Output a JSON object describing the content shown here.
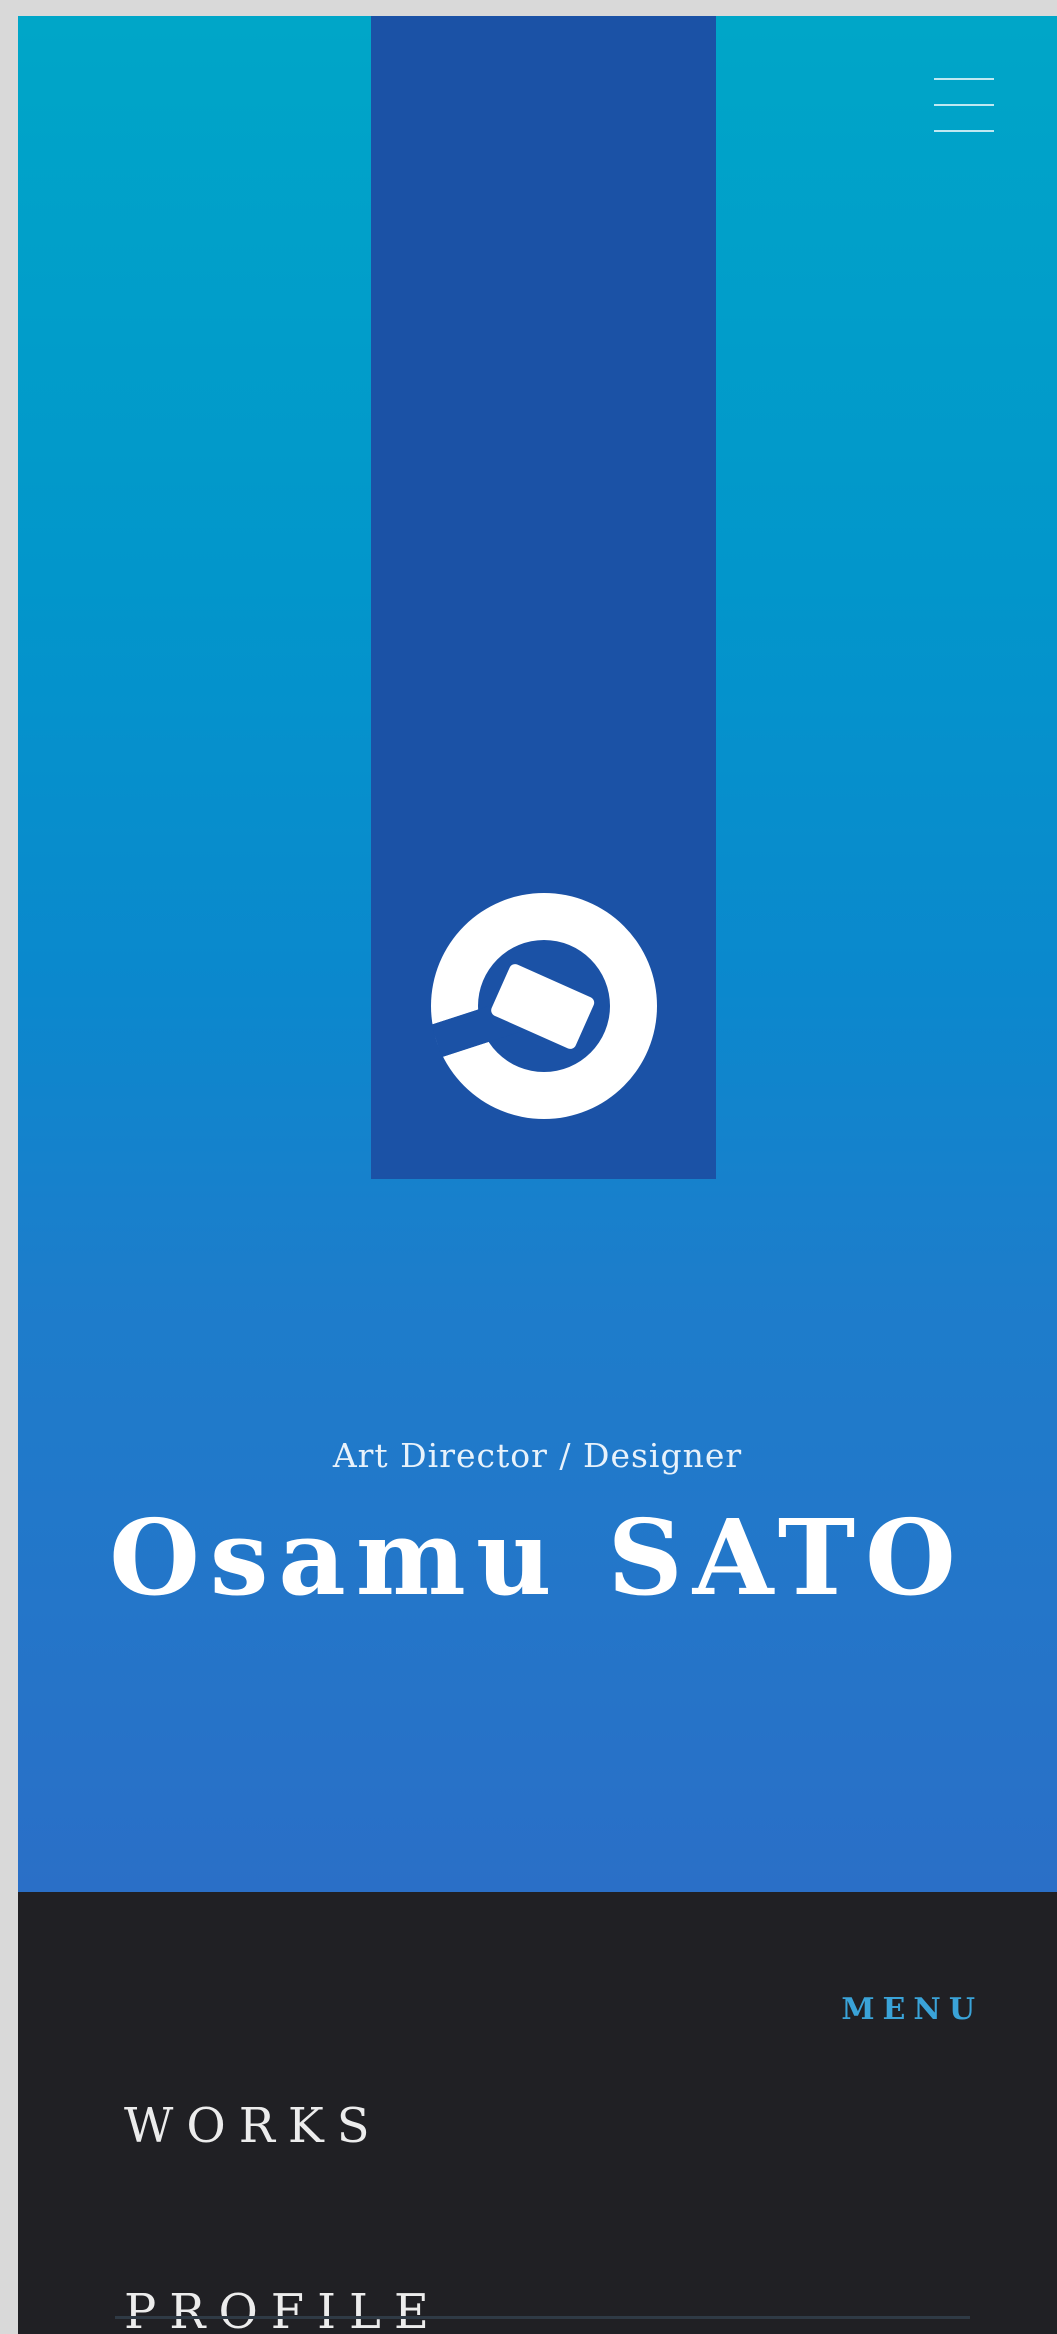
{
  "hero": {
    "subtitle": "Art Director / Designer",
    "name": "Osamu SATO",
    "gradient_top": "#00a6c8",
    "gradient_bottom": "#2a6fc7",
    "banner_color": "#1b52a6"
  },
  "header": {
    "menu_icon": "hamburger-icon"
  },
  "logo": {
    "icon": "logo-mark-icon",
    "color": "#ffffff"
  },
  "menu": {
    "label": "MENU",
    "label_color": "#3aa3d8",
    "background": "#202024",
    "items": [
      {
        "label": "WORKS"
      },
      {
        "label": "PROFILE"
      }
    ]
  }
}
